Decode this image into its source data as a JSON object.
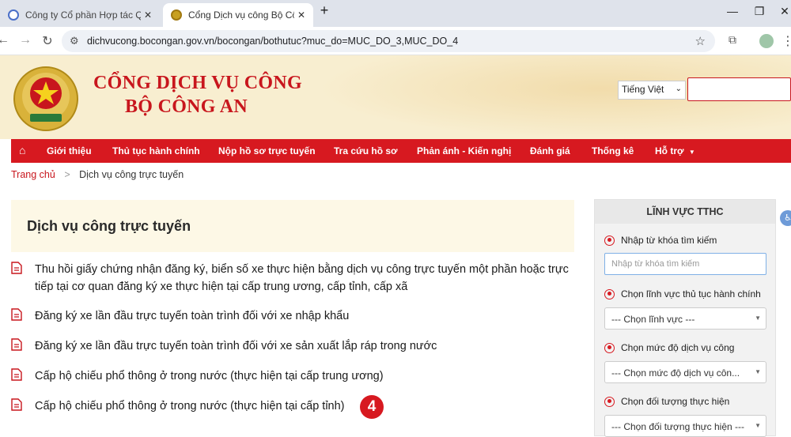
{
  "browser": {
    "tabs": [
      {
        "title": "Công ty Cổ phần Hợp tác Quốc",
        "active": false
      },
      {
        "title": "Cổng Dịch vụ công Bộ Công an",
        "active": true
      }
    ],
    "new_tab": "+",
    "close_glyph": "✕",
    "url": "dichvucong.bocongan.gov.vn/bocongan/bothutuc?muc_do=MUC_DO_3,MUC_DO_4",
    "icons": {
      "back": "back-arrow-icon",
      "forward": "forward-arrow-icon",
      "reload": "reload-icon",
      "site_info": "site-info-icon",
      "bookmark": "star-icon",
      "extensions": "puzzle-icon",
      "menu": "kebab-menu-icon"
    }
  },
  "header": {
    "title_line1": "CỔNG DỊCH VỤ CÔNG",
    "title_line2": "BỘ CÔNG AN",
    "language": "Tiếng Việt",
    "logo": "police-emblem-icon"
  },
  "nav": {
    "home_icon": "home-icon",
    "items": [
      "Giới thiệu",
      "Thủ tục hành chính",
      "Nộp hồ sơ trực tuyến",
      "Tra cứu hồ sơ",
      "Phản ánh - Kiến nghị",
      "Đánh giá",
      "Thống kê",
      "Hỗ trợ"
    ]
  },
  "breadcrumb": {
    "home": "Trang chủ",
    "separator": ">",
    "current": "Dịch vụ công trực tuyến"
  },
  "content": {
    "heading": "Dịch vụ công trực tuyến",
    "services": [
      "Thu hồi giấy chứng nhận đăng ký, biển số xe thực hiện bằng dịch vụ công trực tuyến một phần hoặc trực tiếp tại cơ quan đăng ký xe thực hiện tại cấp trung ương, cấp tỉnh, cấp xã",
      "Đăng ký xe lần đầu trực tuyến toàn trình đối với xe nhập khẩu",
      "Đăng ký xe lần đầu trực tuyến toàn trình đối với xe sản xuất lắp ráp trong nước",
      "Cấp hộ chiếu phổ thông ở trong nước (thực hiện tại cấp trung ương)",
      "Cấp hộ chiếu phổ thông ở trong nước (thực hiện tại cấp tỉnh)"
    ],
    "step_badge": "4"
  },
  "sidebar": {
    "title": "LĨNH VỰC TTHC",
    "keyword_label": "Nhập từ khóa tìm kiếm",
    "keyword_placeholder": "Nhập từ khóa tìm kiếm",
    "field_label": "Chọn lĩnh vực thủ tục hành chính",
    "field_value": "--- Chọn lĩnh vực ---",
    "level_label": "Chọn mức độ dịch vụ công",
    "level_value": "--- Chọn mức độ dịch vụ côn...",
    "target_label": "Chọn đối tượng thực hiện",
    "target_value": "--- Chọn đối tượng thực hiện ---"
  },
  "colors": {
    "brand_red": "#d71920",
    "header_bg": "#f8eed0"
  }
}
